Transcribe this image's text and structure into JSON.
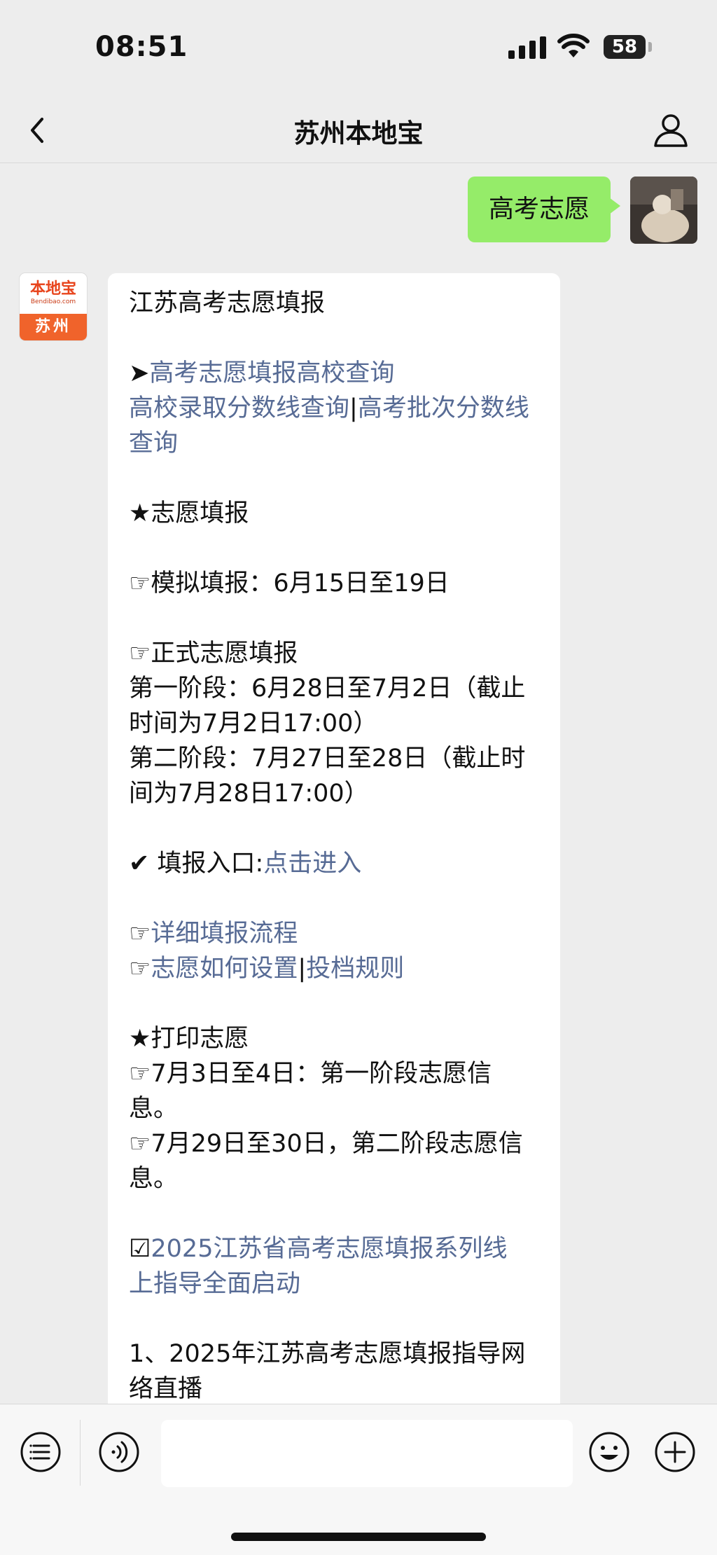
{
  "status": {
    "time": "08:51",
    "battery": "58"
  },
  "nav": {
    "title": "苏州本地宝"
  },
  "outgoing": {
    "text": "高考志愿"
  },
  "bot": {
    "logo_cn": "本地宝",
    "logo_en": "Bendibao.com",
    "logo_city": "苏州"
  },
  "message": {
    "title": "江苏高考志愿填报",
    "arrow_prefix": "➤",
    "link_college_query": "高考志愿填报高校查询",
    "link_cutoff": "高校录取分数线查询",
    "sep": "|",
    "link_batch_a": "高考批次分数线",
    "link_batch_b": "查询",
    "sec_fill": "★志愿填报",
    "sim": "☞模拟填报：6月15日至19日",
    "formal": "☞正式志愿填报",
    "phase1_a": "第一阶段：6月28日至7月2日（截止",
    "phase1_b": "时间为7月2日17:00）",
    "phase2_a": "第二阶段：7月27日至28日（截止时",
    "phase2_b": "间为7月28日17:00）",
    "entry_label": "✔ 填报入口:",
    "entry_link": "点击进入",
    "hand": "☞",
    "link_flow": "详细填报流程",
    "link_setup": "志愿如何设置",
    "link_rules": "投档规则",
    "sec_print": "★打印志愿",
    "print1_a": "☞7月3日至4日：第一阶段志愿信",
    "print1_b": "息。",
    "print2_a": "☞7月29日至30日，第二阶段志愿信",
    "print2_b": "息。",
    "check": "☑",
    "link_2025_a": "2025江苏省高考志愿填报系列线",
    "link_2025_b": "上指导全面启动",
    "item1_a": "1、2025年江苏高考志愿填报指导网",
    "item1_b": "络直播"
  }
}
